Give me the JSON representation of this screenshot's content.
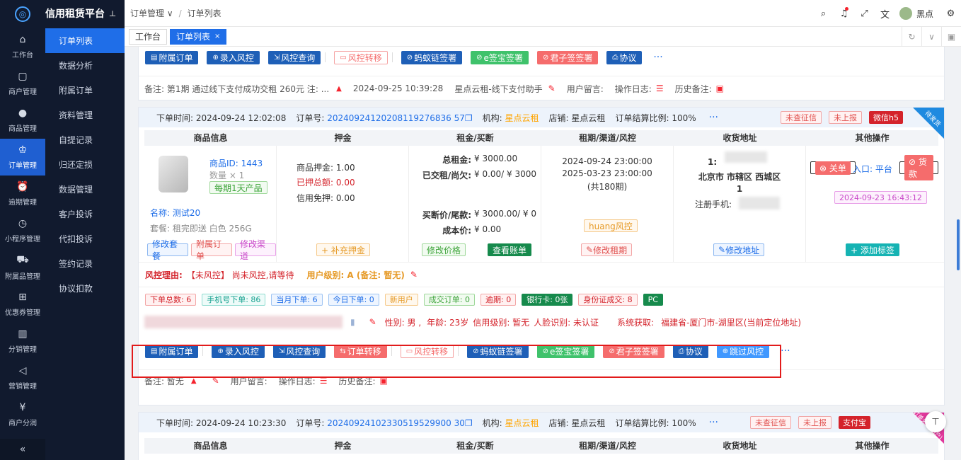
{
  "brand": {
    "title": "信用租赁平台"
  },
  "rail": [
    {
      "label": "工作台",
      "icon": "home-icon"
    },
    {
      "label": "商户管理",
      "icon": "shop-icon"
    },
    {
      "label": "商品管理",
      "icon": "apple-icon"
    },
    {
      "label": "订单管理",
      "icon": "trophy-icon",
      "active": true
    },
    {
      "label": "逾期管理",
      "icon": "alarm-icon"
    },
    {
      "label": "小程序管理",
      "icon": "watch-icon"
    },
    {
      "label": "附属品管理",
      "icon": "cart-icon"
    },
    {
      "label": "优惠券管理",
      "icon": "gift-icon"
    },
    {
      "label": "分销管理",
      "icon": "chart-icon"
    },
    {
      "label": "营销管理",
      "icon": "megaphone-icon"
    },
    {
      "label": "商户分润",
      "icon": "yen-icon"
    }
  ],
  "submenu": [
    "订单列表",
    "数据分析",
    "附属订单",
    "资料管理",
    "自提记录",
    "归还定损",
    "数据管理",
    "客户投诉",
    "代扣投诉",
    "签约记录",
    "协议扣款"
  ],
  "header": {
    "crumb1": "订单管理",
    "crumb2": "订单列表",
    "user": "黑点"
  },
  "tabs": {
    "t1": "工作台",
    "t2": "订单列表"
  },
  "topcard": {
    "buttons": [
      "附属订单",
      "录入风控",
      "风控查询",
      "风控转移",
      "蚂蚁链签署",
      "e签宝签署",
      "君子签签署",
      "协议"
    ],
    "note": {
      "remark": "备注: 第1期 通过线下支付成功交租 260元 注: ...",
      "time": "2024-09-25 10:39:28",
      "who": "星点云租-线下支付助手",
      "msg": "用户留言:",
      "log": "操作日志:",
      "hist": "历史备注:"
    }
  },
  "order1": {
    "time_label": "下单时间:",
    "time": "2024-09-24 12:02:08",
    "no_label": "订单号:",
    "no": "20240924120208119276836 57",
    "org_label": "机构:",
    "org": "星点云租",
    "shop_label": "店铺:",
    "shop": "星点云租",
    "ratio_label": "订单结算比例:",
    "ratio": "100%",
    "tags": [
      "未查征信",
      "未上报",
      "微信h5"
    ],
    "corner": "待发货",
    "cols": [
      "商品信息",
      "押金",
      "租金/买断",
      "租期/渠道/风控",
      "收货地址",
      "其他操作"
    ],
    "goods": {
      "id": "商品ID: 1443",
      "qty": "数量 × 1",
      "badge": "每期1天产品",
      "name_label": "名称:",
      "name": "测试20",
      "pkg": "套餐: 租完即送 白色 256G"
    },
    "goods_btns": [
      "修改套餐",
      "附属订单",
      "修改渠道"
    ],
    "deposit": {
      "l1": "商品押金:",
      "v1": "1.00",
      "l2": "已押总额:",
      "v2": "0.00",
      "l3": "信用免押:",
      "v3": "0.00",
      "btn": "+ 补充押金"
    },
    "rent": {
      "l1": "总租金:",
      "v1": "¥ 3000.00",
      "l2": "已交租/尚欠:",
      "v2": "¥ 0.00/ ¥ 3000",
      "l3": "买断价/尾款:",
      "v3": "¥ 3000.00/ ¥ 0",
      "l4": "成本价:",
      "v4": "¥ 0.00",
      "btn1": "修改价格",
      "btn2": "查看账单"
    },
    "term": {
      "start": "2024-09-24 23:00:00",
      "end": "2025-03-23 23:00:00",
      "periods": "(共180期)",
      "risk_tag": "huang风控",
      "btn": "修改租期"
    },
    "addr": {
      "n1": "1:",
      "city": "北京市 市辖区 西城区",
      "n2": "1",
      "phone_label": "注册手机:",
      "btn": "修改地址"
    },
    "ops": {
      "close": "关单",
      "entry": "入口: 平台",
      "pay": "货款",
      "date": "2024-09-23 16:43:12",
      "addtag": "+ 添加标签"
    },
    "risk": {
      "label": "风控理由:",
      "reason": "【未风控】 尚未风控,请等待",
      "level": "用户级别: A (备注: 暂无)"
    },
    "stats": [
      "下单总数: 6",
      "手机号下单: 86",
      "当月下单: 6",
      "今日下单: 0",
      "新用户",
      "成交订单: 0",
      "逾期: 0",
      "银行卡: 0张",
      "身份证成交: 8",
      "PC"
    ],
    "user": {
      "gender": "性别: 男 ,",
      "age": "年龄: 23岁",
      "credit": "信用级别: 暂无",
      "face": "人脸识别: 未认证",
      "sys": "系统获取:",
      "loc": "福建省-厦门市-湖里区(当前定位地址)"
    },
    "buttons": [
      "附属订单",
      "录入风控",
      "风控查询",
      "订单转移",
      "风控转移",
      "蚂蚁链签署",
      "e签宝签署",
      "君子签签署",
      "协议",
      "跳过风控"
    ],
    "note": {
      "remark": "备注: 暂无",
      "msg": "用户留言:",
      "log": "操作日志:",
      "hist": "历史备注:"
    }
  },
  "order2": {
    "time": "2024-09-24 10:23:30",
    "no": "20240924102330519529900 30",
    "org": "星点云租",
    "shop": "星点云租",
    "ratio": "100%",
    "tags": [
      "未查征信",
      "未上报",
      "支付宝"
    ],
    "corner": "订单关闭(用户)"
  }
}
